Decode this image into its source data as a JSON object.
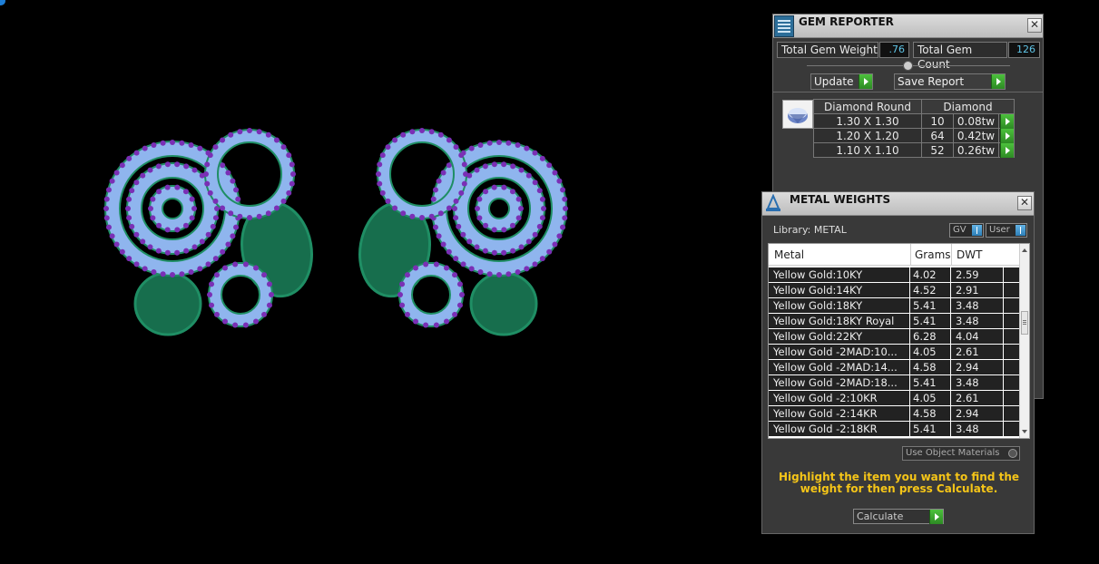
{
  "gem_reporter": {
    "title": "GEM REPORTER",
    "total_weight_label": "Total Gem Weight",
    "total_weight_value": ".76",
    "total_count_label": "Total Gem Count",
    "total_count_value": "126",
    "update_label": "Update",
    "save_report_label": "Save Report",
    "close": "✕",
    "table": {
      "header": [
        "Diamond Round",
        "Diamond"
      ],
      "rows": [
        {
          "size": "1.30 X 1.30",
          "count": "10",
          "weight": "0.08tw"
        },
        {
          "size": "1.20 X 1.20",
          "count": "64",
          "weight": "0.42tw"
        },
        {
          "size": "1.10 X 1.10",
          "count": "52",
          "weight": "0.26tw"
        }
      ]
    }
  },
  "metal_weights": {
    "title": "METAL WEIGHTS",
    "library_label": "Library: METAL",
    "gv_label": "GV",
    "user_label": "User",
    "close": "✕",
    "columns": [
      "Metal",
      "Grams",
      "DWT"
    ],
    "rows": [
      {
        "metal": "Yellow Gold:10KY",
        "grams": "4.02",
        "dwt": "2.59"
      },
      {
        "metal": "Yellow Gold:14KY",
        "grams": "4.52",
        "dwt": "2.91"
      },
      {
        "metal": "Yellow Gold:18KY",
        "grams": "5.41",
        "dwt": "3.48"
      },
      {
        "metal": "Yellow Gold:18KY Royal",
        "grams": "5.41",
        "dwt": "3.48"
      },
      {
        "metal": "Yellow Gold:22KY",
        "grams": "6.28",
        "dwt": "4.04"
      },
      {
        "metal": "Yellow Gold -2MAD:10...",
        "grams": "4.05",
        "dwt": "2.61"
      },
      {
        "metal": "Yellow Gold -2MAD:14...",
        "grams": "4.58",
        "dwt": "2.94"
      },
      {
        "metal": "Yellow Gold -2MAD:18...",
        "grams": "5.41",
        "dwt": "3.48"
      },
      {
        "metal": "Yellow Gold -2:10KR",
        "grams": "4.05",
        "dwt": "2.61"
      },
      {
        "metal": "Yellow Gold -2:14KR",
        "grams": "4.58",
        "dwt": "2.94"
      },
      {
        "metal": "Yellow Gold -2:18KR",
        "grams": "5.41",
        "dwt": "3.48"
      }
    ],
    "use_object_materials": "Use Object Materials",
    "hint": "Highlight the item you want to find the weight for then press Calculate.",
    "calculate_label": "Calculate"
  },
  "colors": {
    "metal_green": "#1f8e64",
    "stone_blue": "#8fb5ee",
    "stone_purple": "#7a2fb5",
    "hint_yellow": "#f5c518"
  }
}
